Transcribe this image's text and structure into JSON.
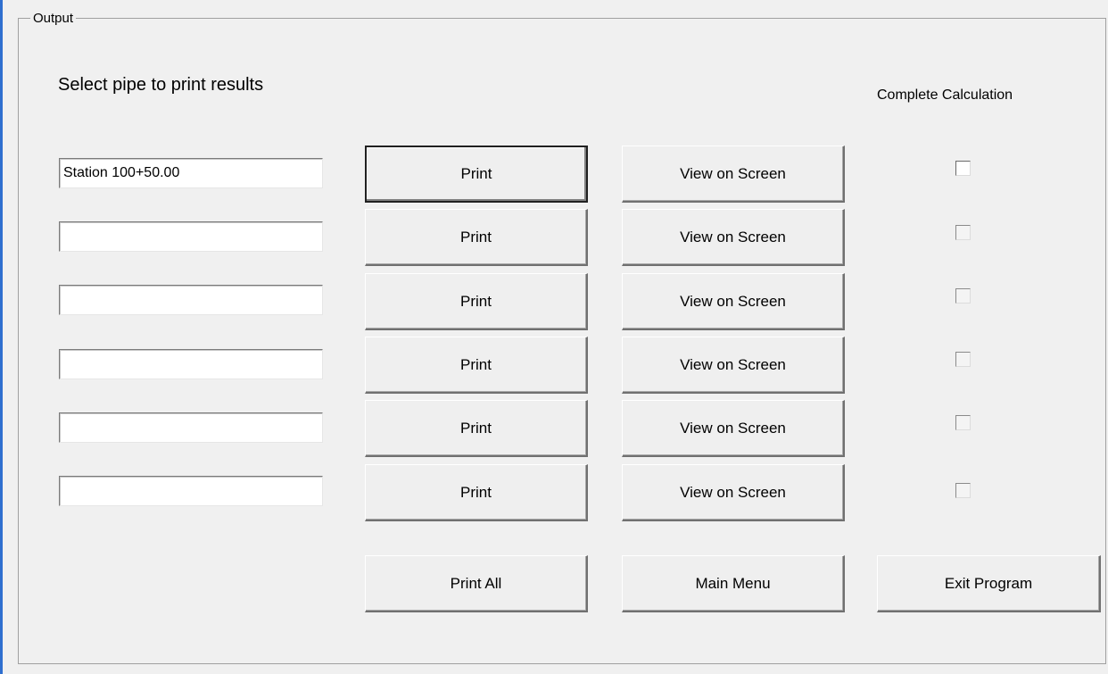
{
  "group": {
    "title": "Output"
  },
  "heading": "Select pipe to print results",
  "column_heading": "Complete Calculation",
  "rows": [
    {
      "pipe": "Station 100+50.00",
      "print_label": "Print",
      "view_label": "View on Screen",
      "complete": false
    },
    {
      "pipe": "",
      "print_label": "Print",
      "view_label": "View on Screen",
      "complete": false
    },
    {
      "pipe": "",
      "print_label": "Print",
      "view_label": "View on Screen",
      "complete": false
    },
    {
      "pipe": "",
      "print_label": "Print",
      "view_label": "View on Screen",
      "complete": false
    },
    {
      "pipe": "",
      "print_label": "Print",
      "view_label": "View on Screen",
      "complete": false
    },
    {
      "pipe": "",
      "print_label": "Print",
      "view_label": "View on Screen",
      "complete": false
    }
  ],
  "footer": {
    "print_all_label": "Print All",
    "main_menu_label": "Main Menu",
    "exit_label": "Exit Program"
  }
}
